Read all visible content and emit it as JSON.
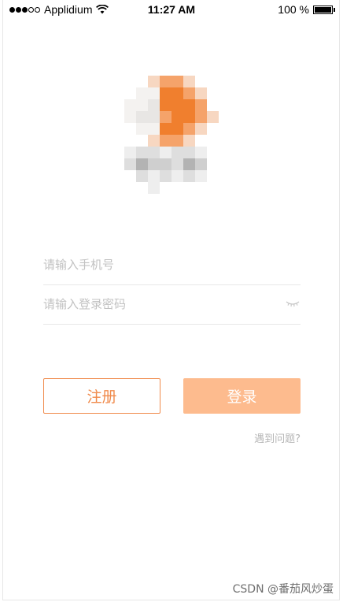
{
  "status_bar": {
    "carrier": "Applidium",
    "time": "11:27 AM",
    "battery": "100 %",
    "signal_bars_filled": 3,
    "signal_bars_total": 5
  },
  "logo": {
    "icon": "app-logo",
    "colors": {
      "orange": "#f07f2e",
      "light_orange": "#f6a66b",
      "pale": "#f3efec",
      "gray": "#bdbdbd"
    }
  },
  "form": {
    "phone_placeholder": "请输入手机号",
    "password_placeholder": "请输入登录密码",
    "password_toggle_icon": "eye-closed-icon"
  },
  "buttons": {
    "register": "注册",
    "login": "登录"
  },
  "help_link": "遇到问题?",
  "watermark": "CSDN @番茄风炒蛋",
  "colors": {
    "accent": "#f08a4b",
    "login_bg": "#fdbb8e",
    "placeholder": "#c2c2c2",
    "divider": "#e8e8e8"
  }
}
